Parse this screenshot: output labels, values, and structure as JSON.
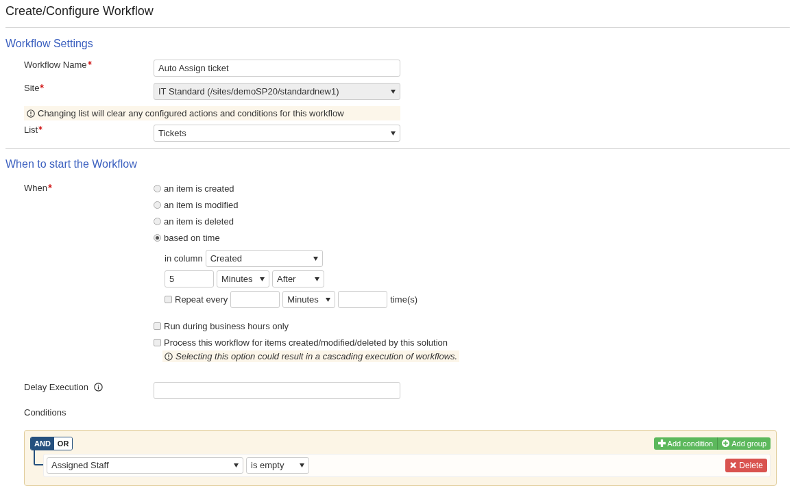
{
  "title": "Create/Configure Workflow",
  "settings": {
    "heading": "Workflow Settings",
    "name": {
      "label": "Workflow Name",
      "required": true,
      "value": "Auto Assign ticket"
    },
    "site": {
      "label": "Site",
      "required": true,
      "value": "IT Standard (/sites/demoSP20/standardnew1)",
      "disabled": true
    },
    "warning": "Changing list will clear any configured actions and conditions for this workflow",
    "list": {
      "label": "List",
      "required": true,
      "value": "Tickets",
      "disabled": false
    }
  },
  "start": {
    "heading": "When to start the Workflow",
    "when": {
      "label": "When",
      "required": true
    },
    "options": [
      {
        "label": "an item is created",
        "selected": false
      },
      {
        "label": "an item is modified",
        "selected": false
      },
      {
        "label": "an item is deleted",
        "selected": false
      },
      {
        "label": "based on time",
        "selected": true
      }
    ],
    "time": {
      "column_label": "in column",
      "column": "Created",
      "amount": "5",
      "unit": "Minutes",
      "direction": "After",
      "repeat": {
        "label": "Repeat every",
        "checked": false,
        "unit": "Minutes",
        "suffix": "time(s)"
      }
    },
    "checks": [
      {
        "label": "Run during business hours only",
        "checked": false
      },
      {
        "label": "Process this workflow for items created/modified/deleted by this solution",
        "checked": false,
        "note": "Selecting this option could result in a cascading execution of workflows."
      }
    ],
    "delay": {
      "label": "Delay Execution"
    },
    "conditions": {
      "label": "Conditions",
      "logic": [
        {
          "label": "AND",
          "selected": true
        },
        {
          "label": "OR",
          "selected": false
        }
      ],
      "add_condition": "Add condition",
      "add_group": "Add group",
      "rules": [
        {
          "field": "Assigned Staff",
          "operator": "is empty",
          "delete": "Delete"
        }
      ]
    }
  }
}
